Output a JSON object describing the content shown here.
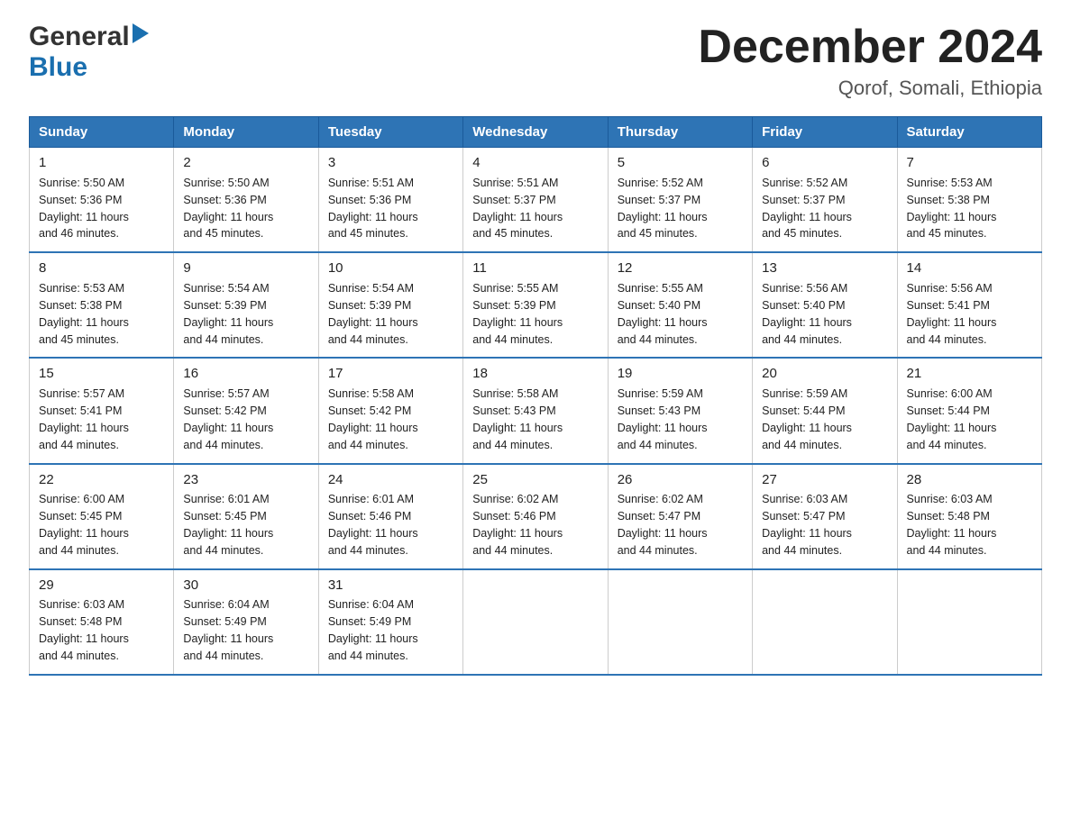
{
  "logo": {
    "general": "General",
    "blue": "Blue",
    "triangle": "▶"
  },
  "title": "December 2024",
  "subtitle": "Qorof, Somali, Ethiopia",
  "days_of_week": [
    "Sunday",
    "Monday",
    "Tuesday",
    "Wednesday",
    "Thursday",
    "Friday",
    "Saturday"
  ],
  "weeks": [
    [
      {
        "day": "1",
        "sunrise": "5:50 AM",
        "sunset": "5:36 PM",
        "daylight": "11 hours and 46 minutes."
      },
      {
        "day": "2",
        "sunrise": "5:50 AM",
        "sunset": "5:36 PM",
        "daylight": "11 hours and 45 minutes."
      },
      {
        "day": "3",
        "sunrise": "5:51 AM",
        "sunset": "5:36 PM",
        "daylight": "11 hours and 45 minutes."
      },
      {
        "day": "4",
        "sunrise": "5:51 AM",
        "sunset": "5:37 PM",
        "daylight": "11 hours and 45 minutes."
      },
      {
        "day": "5",
        "sunrise": "5:52 AM",
        "sunset": "5:37 PM",
        "daylight": "11 hours and 45 minutes."
      },
      {
        "day": "6",
        "sunrise": "5:52 AM",
        "sunset": "5:37 PM",
        "daylight": "11 hours and 45 minutes."
      },
      {
        "day": "7",
        "sunrise": "5:53 AM",
        "sunset": "5:38 PM",
        "daylight": "11 hours and 45 minutes."
      }
    ],
    [
      {
        "day": "8",
        "sunrise": "5:53 AM",
        "sunset": "5:38 PM",
        "daylight": "11 hours and 45 minutes."
      },
      {
        "day": "9",
        "sunrise": "5:54 AM",
        "sunset": "5:39 PM",
        "daylight": "11 hours and 44 minutes."
      },
      {
        "day": "10",
        "sunrise": "5:54 AM",
        "sunset": "5:39 PM",
        "daylight": "11 hours and 44 minutes."
      },
      {
        "day": "11",
        "sunrise": "5:55 AM",
        "sunset": "5:39 PM",
        "daylight": "11 hours and 44 minutes."
      },
      {
        "day": "12",
        "sunrise": "5:55 AM",
        "sunset": "5:40 PM",
        "daylight": "11 hours and 44 minutes."
      },
      {
        "day": "13",
        "sunrise": "5:56 AM",
        "sunset": "5:40 PM",
        "daylight": "11 hours and 44 minutes."
      },
      {
        "day": "14",
        "sunrise": "5:56 AM",
        "sunset": "5:41 PM",
        "daylight": "11 hours and 44 minutes."
      }
    ],
    [
      {
        "day": "15",
        "sunrise": "5:57 AM",
        "sunset": "5:41 PM",
        "daylight": "11 hours and 44 minutes."
      },
      {
        "day": "16",
        "sunrise": "5:57 AM",
        "sunset": "5:42 PM",
        "daylight": "11 hours and 44 minutes."
      },
      {
        "day": "17",
        "sunrise": "5:58 AM",
        "sunset": "5:42 PM",
        "daylight": "11 hours and 44 minutes."
      },
      {
        "day": "18",
        "sunrise": "5:58 AM",
        "sunset": "5:43 PM",
        "daylight": "11 hours and 44 minutes."
      },
      {
        "day": "19",
        "sunrise": "5:59 AM",
        "sunset": "5:43 PM",
        "daylight": "11 hours and 44 minutes."
      },
      {
        "day": "20",
        "sunrise": "5:59 AM",
        "sunset": "5:44 PM",
        "daylight": "11 hours and 44 minutes."
      },
      {
        "day": "21",
        "sunrise": "6:00 AM",
        "sunset": "5:44 PM",
        "daylight": "11 hours and 44 minutes."
      }
    ],
    [
      {
        "day": "22",
        "sunrise": "6:00 AM",
        "sunset": "5:45 PM",
        "daylight": "11 hours and 44 minutes."
      },
      {
        "day": "23",
        "sunrise": "6:01 AM",
        "sunset": "5:45 PM",
        "daylight": "11 hours and 44 minutes."
      },
      {
        "day": "24",
        "sunrise": "6:01 AM",
        "sunset": "5:46 PM",
        "daylight": "11 hours and 44 minutes."
      },
      {
        "day": "25",
        "sunrise": "6:02 AM",
        "sunset": "5:46 PM",
        "daylight": "11 hours and 44 minutes."
      },
      {
        "day": "26",
        "sunrise": "6:02 AM",
        "sunset": "5:47 PM",
        "daylight": "11 hours and 44 minutes."
      },
      {
        "day": "27",
        "sunrise": "6:03 AM",
        "sunset": "5:47 PM",
        "daylight": "11 hours and 44 minutes."
      },
      {
        "day": "28",
        "sunrise": "6:03 AM",
        "sunset": "5:48 PM",
        "daylight": "11 hours and 44 minutes."
      }
    ],
    [
      {
        "day": "29",
        "sunrise": "6:03 AM",
        "sunset": "5:48 PM",
        "daylight": "11 hours and 44 minutes."
      },
      {
        "day": "30",
        "sunrise": "6:04 AM",
        "sunset": "5:49 PM",
        "daylight": "11 hours and 44 minutes."
      },
      {
        "day": "31",
        "sunrise": "6:04 AM",
        "sunset": "5:49 PM",
        "daylight": "11 hours and 44 minutes."
      },
      null,
      null,
      null,
      null
    ]
  ],
  "labels": {
    "sunrise": "Sunrise:",
    "sunset": "Sunset:",
    "daylight": "Daylight:"
  }
}
